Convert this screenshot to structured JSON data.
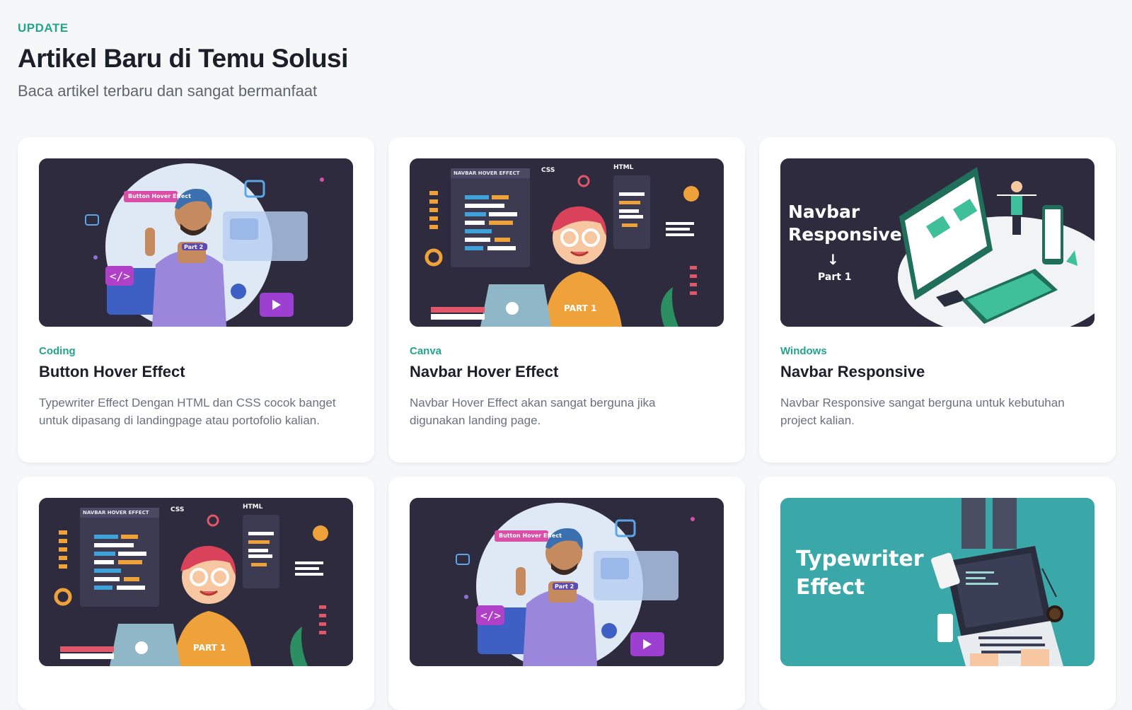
{
  "header": {
    "eyebrow": "UPDATE",
    "title": "Artikel Baru di Temu Solusi",
    "subtitle": "Baca artikel terbaru dan sangat bermanfaat"
  },
  "cards": [
    {
      "category": "Coding",
      "title": "Button Hover Effect",
      "description": "Typewriter Effect Dengan HTML dan CSS cocok banget untuk dipasang di landingpage atau portofolio kalian.",
      "thumbnail": {
        "tag": "Button Hover Effect",
        "shirt": "Part 2"
      }
    },
    {
      "category": "Canva",
      "title": "Navbar Hover Effect",
      "description": "Navbar Hover Effect akan sangat berguna jika digunakan landing page.",
      "thumbnail": {
        "window_title": "NAVBAR HOVER EFFECT",
        "css": "CSS",
        "html": "HTML",
        "shirt": "PART 1"
      }
    },
    {
      "category": "Windows",
      "title": "Navbar Responsive",
      "description": "Navbar Responsive sangat berguna untuk kebutuhan project kalian.",
      "thumbnail": {
        "line1": "Navbar",
        "line2": "Responsive",
        "arrow": "↓",
        "part": "Part 1"
      }
    },
    {
      "thumbnail": {
        "window_title": "NAVBAR HOVER EFFECT",
        "css": "CSS",
        "html": "HTML",
        "shirt": "PART 1"
      }
    },
    {
      "thumbnail": {
        "tag": "Button Hover Effect",
        "shirt": "Part 2"
      }
    },
    {
      "thumbnail": {
        "line1": "Typewriter",
        "line2": "Effect"
      }
    }
  ],
  "colors": {
    "accent": "#22a38c",
    "thumb_dark": "#2d2b3d",
    "thumb_teal": "#3aa7a8",
    "orange": "#f0a23a",
    "purple": "#8f6fd8"
  }
}
